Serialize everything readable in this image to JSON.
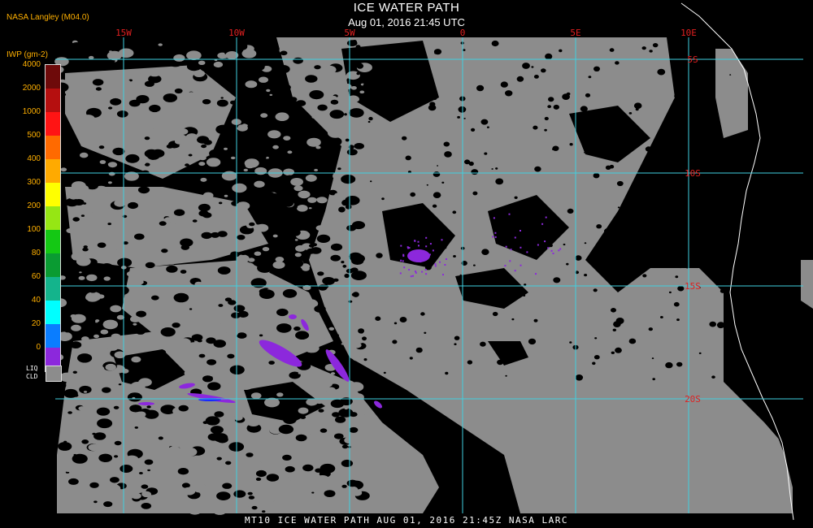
{
  "header": {
    "credit": "NASA Langley (M04.0)",
    "title": "ICE WATER PATH",
    "subtitle": "Aug 01, 2016 21:45 UTC"
  },
  "legend": {
    "title": "IWP (gm-2)",
    "bins": [
      {
        "label": "4000",
        "color": "#6e0a0a"
      },
      {
        "label": "2000",
        "color": "#b50f0f"
      },
      {
        "label": "1000",
        "color": "#ff1414"
      },
      {
        "label": "500",
        "color": "#ff6a00"
      },
      {
        "label": "400",
        "color": "#ffaa00"
      },
      {
        "label": "300",
        "color": "#ffff00"
      },
      {
        "label": "200",
        "color": "#96e614"
      },
      {
        "label": "100",
        "color": "#14c814"
      },
      {
        "label": "80",
        "color": "#0a9b32"
      },
      {
        "label": "60",
        "color": "#14b48c"
      },
      {
        "label": "40",
        "color": "#00ffff"
      },
      {
        "label": "20",
        "color": "#0a7dff"
      },
      {
        "label": "0",
        "color": "#1428ff"
      }
    ],
    "bottom_color": "#8c28dc",
    "liq_label_1": "LIQ",
    "liq_label_2": "CLD",
    "liq_color": "#8c8c8c"
  },
  "map": {
    "grid_color": "#40d0e0",
    "label_color": "#e02020",
    "lon_labels": [
      "15W",
      "10W",
      "5W",
      "0",
      "5E",
      "10E"
    ],
    "lat_labels": [
      "5S",
      "10S",
      "15S",
      "20S"
    ],
    "cloud_color": "#8c8c8c",
    "ice_color": "#8c28dc",
    "ice_dense_color": "#1428ff"
  },
  "footer": {
    "text": "MT10  ICE WATER PATH   AUG 01, 2016 21:45Z   NASA LARC"
  }
}
